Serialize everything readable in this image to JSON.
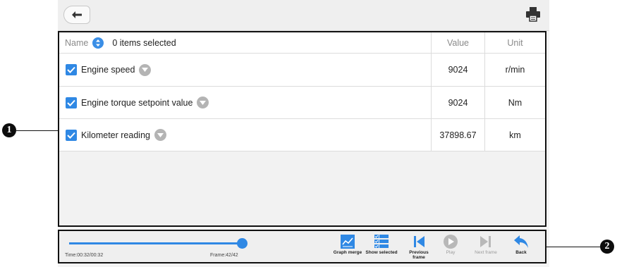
{
  "toolbar": {
    "back_icon": "back-arrow-icon",
    "print_icon": "printer-icon"
  },
  "table": {
    "header": {
      "name_label": "Name",
      "selected_text": "0 items selected",
      "value_label": "Value",
      "unit_label": "Unit"
    },
    "rows": [
      {
        "name": "Engine speed",
        "value": "9024",
        "unit": "r/min",
        "checked": true
      },
      {
        "name": "Engine torque setpoint value",
        "value": "9024",
        "unit": "Nm",
        "checked": true
      },
      {
        "name": "Kilometer reading",
        "value": "37898.67",
        "unit": "km",
        "checked": true
      }
    ]
  },
  "playback": {
    "time_text": "Time:00:32/00:32",
    "frame_text": "Frame:42/42",
    "progress": 1.0,
    "buttons": {
      "graph_merge": "Graph merge",
      "show_selected": "Show selected",
      "previous_frame": "Previous frame",
      "play": "Play",
      "next_frame": "Next frame",
      "back": "Back"
    }
  },
  "callouts": {
    "one": "1",
    "two": "2"
  },
  "colors": {
    "accent": "#2f88e4",
    "muted": "#b4b4b4",
    "frame_border": "#111111"
  }
}
